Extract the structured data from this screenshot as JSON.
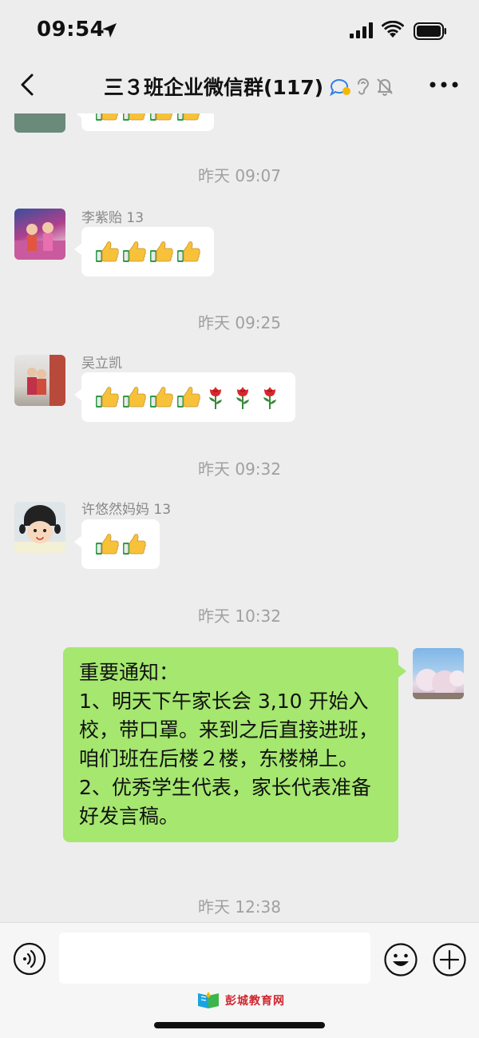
{
  "status_bar": {
    "time": "09:54"
  },
  "nav": {
    "title": "三３班企业微信群(117)"
  },
  "messages": [
    {
      "type": "time",
      "text": "昨天 09:07"
    },
    {
      "sender": "李紫贻 13",
      "emoji": [
        "thumbs-up",
        "thumbs-up",
        "thumbs-up",
        "thumbs-up"
      ]
    },
    {
      "type": "time",
      "text": "昨天 09:25"
    },
    {
      "sender": "吴立凯",
      "emoji": [
        "thumbs-up",
        "thumbs-up",
        "thumbs-up",
        "thumbs-up",
        "rose",
        "rose",
        "rose"
      ]
    },
    {
      "type": "time",
      "text": "昨天 09:32"
    },
    {
      "sender": "许悠然妈妈 13",
      "emoji": [
        "thumbs-up",
        "thumbs-up"
      ]
    },
    {
      "type": "time",
      "text": "昨天 10:32"
    },
    {
      "self": true,
      "lines": [
        "重要通知：",
        "1、明天下午家长会 3,10 开始入校，带口罩。来到之后直接进班，咱们班在后楼２楼，东楼梯上。",
        "2、优秀学生代表，家长代表准备好发言稿。"
      ]
    },
    {
      "type": "time",
      "text": "昨天 12:38"
    }
  ],
  "footer": {
    "watermark": "彭城教育网"
  },
  "colors": {
    "background": "#ededed",
    "self_bubble": "#a5e76f",
    "other_bubble": "#ffffff",
    "time_text": "#a0a0a0"
  }
}
